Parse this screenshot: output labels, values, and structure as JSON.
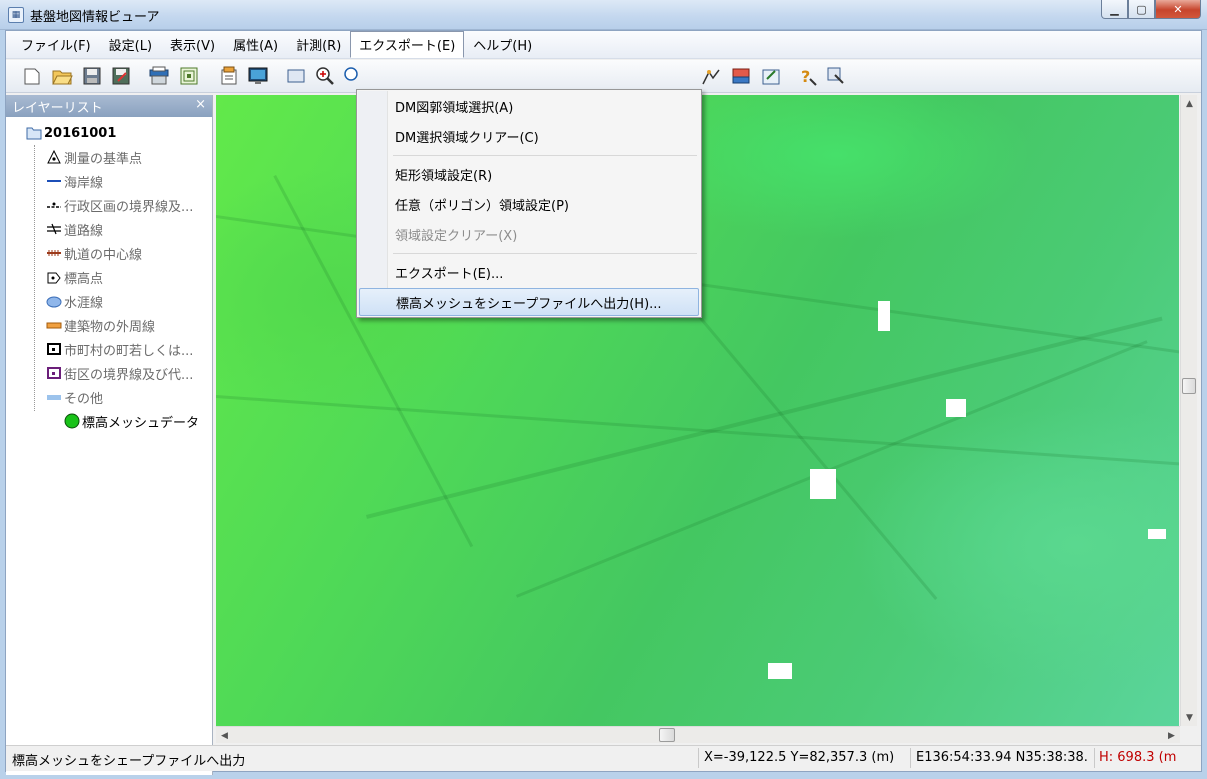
{
  "window": {
    "title": "基盤地図情報ビューア",
    "app_icon_text": "kiban",
    "min_label": "▭",
    "max_label": "□",
    "close_label": "✕"
  },
  "menubar": [
    {
      "label": "ファイル(F)"
    },
    {
      "label": "設定(L)"
    },
    {
      "label": "表示(V)"
    },
    {
      "label": "属性(A)"
    },
    {
      "label": "計測(R)"
    },
    {
      "label": "エクスポート(E)"
    },
    {
      "label": "ヘルプ(H)"
    }
  ],
  "export_menu": {
    "items": [
      {
        "label": "DM図郭領域選択(A)",
        "enabled": true
      },
      {
        "label": "DM選択領域クリアー(C)",
        "enabled": true
      },
      {
        "label": "矩形領域設定(R)",
        "enabled": true
      },
      {
        "label": "任意（ポリゴン）領域設定(P)",
        "enabled": true
      },
      {
        "label": "領域設定クリアー(X)",
        "enabled": false
      },
      {
        "label": "エクスポート(E)...",
        "enabled": true
      },
      {
        "label": "標高メッシュをシェープファイルへ出力(H)...",
        "enabled": true,
        "highlighted": true
      }
    ]
  },
  "layer_panel": {
    "title": "レイヤーリスト",
    "close_label": "×",
    "root": "20161001",
    "items": [
      {
        "label": "測量の基準点",
        "icon": "survey-point-icon"
      },
      {
        "label": "海岸線",
        "icon": "coastline-icon"
      },
      {
        "label": "行政区画の境界線及...",
        "icon": "admin-boundary-icon"
      },
      {
        "label": "道路線",
        "icon": "road-line-icon"
      },
      {
        "label": "軌道の中心線",
        "icon": "railway-icon"
      },
      {
        "label": "標高点",
        "icon": "elevation-point-icon"
      },
      {
        "label": "水涯線",
        "icon": "waterline-icon"
      },
      {
        "label": "建築物の外周線",
        "icon": "building-outline-icon"
      },
      {
        "label": "市町村の町若しくは...",
        "icon": "town-boundary-icon"
      },
      {
        "label": "街区の境界線及び代...",
        "icon": "block-boundary-icon"
      },
      {
        "label": "その他",
        "icon": "other-icon"
      }
    ],
    "active_item": {
      "label": "標高メッシュデータ",
      "icon": "elevation-mesh-icon",
      "color": "#19c219"
    }
  },
  "statusbar": {
    "message": "標高メッシュをシェープファイルへ出力",
    "xy": "X=-39,122.5 Y=82,357.3 (m)",
    "latlon": "E136:54:33.94 N35:38:38.",
    "height": "H: 698.3 (m",
    "height_color": "#c00000"
  }
}
